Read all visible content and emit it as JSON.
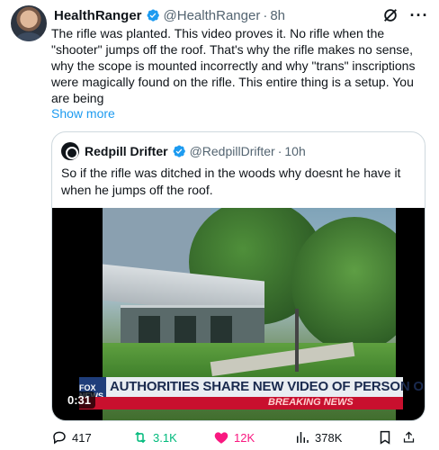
{
  "author": {
    "name": "HealthRanger",
    "handle": "@HealthRanger",
    "time": "8h"
  },
  "post": {
    "text": "The rifle was planted. This video proves it. No rifle when the \"shooter\" jumps off the roof. That's why the rifle makes no sense, why the scope is mounted incorrectly and why \"trans\" inscriptions were magically found on the rifle. This entire thing is a setup. You are being",
    "show_more": "Show more"
  },
  "quote": {
    "name": "Redpill Drifter",
    "handle": "@RedpillDrifter",
    "time": "10h",
    "text": "So if the rifle was ditched in the woods why doesnt he have it when he jumps off the roof."
  },
  "video": {
    "duration": "0:31",
    "chyron": "AUTHORITIES SHARE NEW VIDEO OF PERSON OF",
    "breaking": "BREAKING NEWS",
    "channel_logo": "FOX NEWS"
  },
  "actions": {
    "replies": "417",
    "reposts": "3.1K",
    "likes": "12K",
    "views": "378K"
  },
  "icons": {
    "verified": "verified-badge-icon",
    "grok": "grok-icon",
    "more": "more-icon",
    "reply": "reply-icon",
    "repost": "repost-icon",
    "like": "heart-icon",
    "views": "views-icon",
    "bookmark": "bookmark-icon",
    "share": "share-icon"
  },
  "colors": {
    "link": "#1d9bf0",
    "verified": "#1d9bf0",
    "repost": "#00ba7c",
    "like": "#f91880",
    "muted": "#536471"
  }
}
